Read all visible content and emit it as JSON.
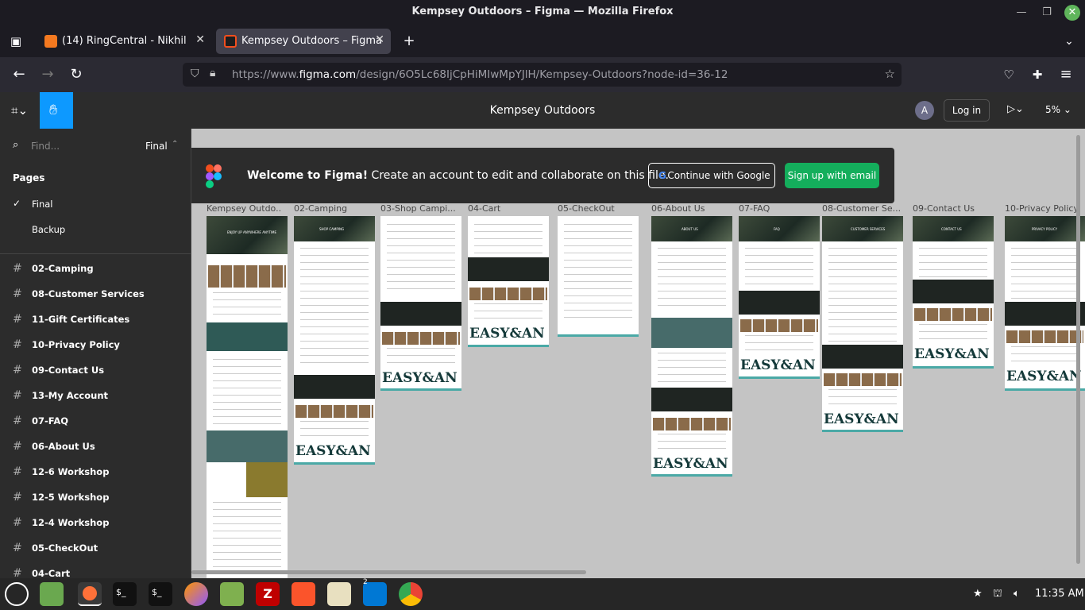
{
  "window": {
    "title": "Kempsey Outdoors – Figma — Mozilla Firefox"
  },
  "tabs": [
    {
      "label": "(14) RingCentral - Nikhil",
      "active": false
    },
    {
      "label": "Kempsey Outdoors – Figma",
      "active": true
    }
  ],
  "url": {
    "prefix": "https://www.",
    "domain": "figma.com",
    "path": "/design/6O5Lc68IjCpHiMIwMpYJlH/Kempsey-Outdoors?node-id=36-12"
  },
  "figma": {
    "file_title": "Kempsey Outdoors",
    "avatar_letter": "A",
    "login_label": "Log in",
    "zoom": "5%"
  },
  "sidebar": {
    "find_placeholder": "Find...",
    "current_page": "Final",
    "pages_heading": "Pages",
    "pages": [
      "Final",
      "Backup"
    ],
    "layers": [
      "02-Camping",
      "08-Customer Services",
      "11-Gift Certificates",
      "10-Privacy Policy",
      "09-Contact Us",
      "13-My Account",
      "07-FAQ",
      "06-About Us",
      "12-6 Workshop",
      "12-5 Workshop",
      "12-4 Workshop",
      "05-CheckOut",
      "04-Cart"
    ]
  },
  "banner": {
    "bold": "Welcome to Figma!",
    "text": " Create an account to edit and collaborate on this file.",
    "google_button": "Continue with Google",
    "email_button": "Sign up with email"
  },
  "frames": [
    "Kempsey Outdo...",
    "02-Camping",
    "03-Shop Campi...",
    "04-Cart",
    "05-CheckOut",
    "06-About Us",
    "07-FAQ",
    "08-Customer Se...",
    "09-Contact Us",
    "10-Privacy Policy"
  ],
  "frame_texts": {
    "logo": "EASY&AN",
    "hero_headings": [
      "ENJOY UP ANYWHERE ANYTIME",
      "SHOP CAMPING",
      "ABOUT US",
      "FAQ",
      "CUSTOMER SERVICES",
      "CONTACT US",
      "PRIVACY POLICY"
    ]
  },
  "taskbar": {
    "clock": "11:35 AM",
    "vscode_badge": "2"
  },
  "colors": {
    "accent": "#0d99ff",
    "green": "#14ae5c",
    "canvas": "#c4c4c4",
    "teal": "#4aa9a6"
  }
}
